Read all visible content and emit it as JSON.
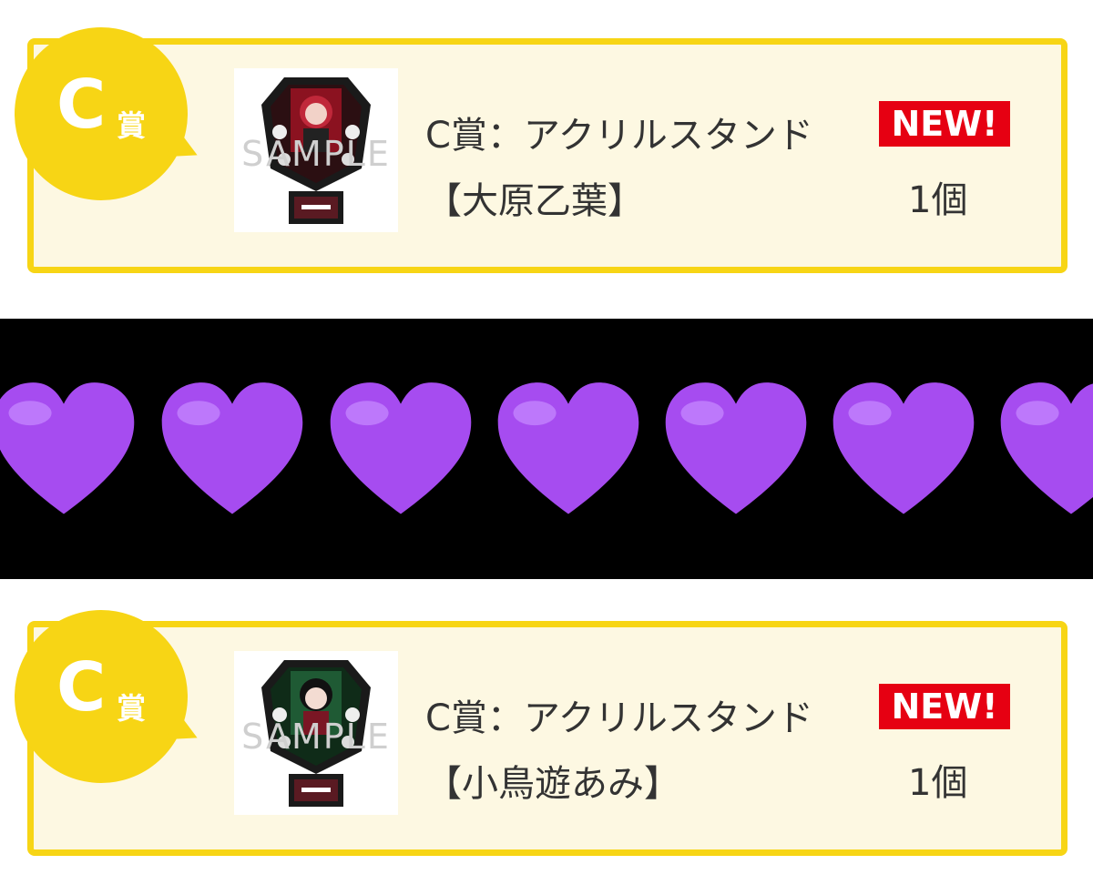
{
  "prizes": [
    {
      "rank": "C",
      "rank_suffix": "賞",
      "watermark": "SAMPLE",
      "name": "C賞：アクリルスタンド【大原乙葉】",
      "badge": "NEW!",
      "quantity": "1個"
    },
    {
      "rank": "C",
      "rank_suffix": "賞",
      "watermark": "SAMPLE",
      "name": "C賞：アクリルスタンド【小鳥遊あみ】",
      "badge": "NEW!",
      "quantity": "1個"
    }
  ],
  "heart_band": {
    "emoji": "purple-heart",
    "count": 7,
    "color": "#a64cf0"
  },
  "colors": {
    "card_border": "#f7d515",
    "card_bg": "#fdf8e2",
    "badge_red": "#e60012"
  }
}
